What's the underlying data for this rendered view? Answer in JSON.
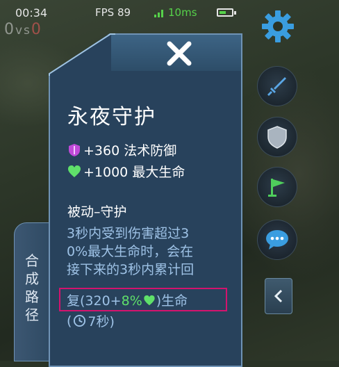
{
  "status_bar": {
    "time": "00:34",
    "fps": "FPS 89",
    "ping": "10ms"
  },
  "score": {
    "left": "0",
    "vs": "vs",
    "right": "0"
  },
  "item_panel": {
    "title": "永夜守护",
    "stats": [
      {
        "icon": "magic-defense-icon",
        "text": "+360 法术防御"
      },
      {
        "icon": "max-hp-heart-icon",
        "text": "+1000 最大生命"
      }
    ],
    "passive": {
      "name": "被动–守护",
      "line1": "3秒内受到伤害超过3",
      "line2": "0%最大生命时，会在",
      "line3": "接下来的3秒内累计回",
      "heal_prefix": "复(320+",
      "heal_percent": "8%",
      "heal_suffix": ")生命",
      "cooldown_open": "(",
      "cooldown_text": "7秒)"
    },
    "side_tab_label": "合成路径"
  },
  "right_column": {
    "icons": [
      "settings-gear-icon",
      "attack-sword-icon",
      "defense-shield-icon",
      "retreat-flag-icon",
      "chat-bubble-icon",
      "collapse-arrow-icon"
    ]
  },
  "colors": {
    "panel_bg": "#28425c",
    "panel_border": "#6f93b5",
    "desc_text": "#9ec2e6",
    "heal_green": "#5fe06a",
    "highlight_box": "#d4136e",
    "ping_green": "#56d24a"
  }
}
